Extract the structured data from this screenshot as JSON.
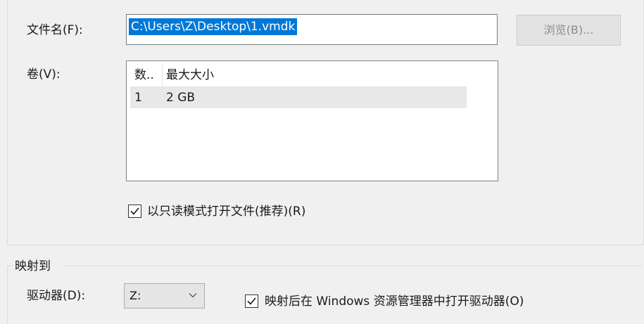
{
  "file": {
    "label": "文件名(F):",
    "value": "C:\\Users\\Z\\Desktop\\1.vmdk",
    "browse_label": "浏览(B)..."
  },
  "volumes": {
    "label": "卷(V):",
    "columns": [
      "数..",
      "最大大小"
    ],
    "rows": [
      {
        "num": "1",
        "size": "2 GB"
      }
    ]
  },
  "readonly": {
    "label": "以只读模式打开文件(推荐)(R)",
    "checked": true
  },
  "mapping": {
    "group_title": "映射到",
    "drive_label": "驱动器(D):",
    "drive_value": "Z:",
    "open_label": "映射后在 Windows 资源管理器中打开驱动器(O)",
    "open_checked": true
  }
}
